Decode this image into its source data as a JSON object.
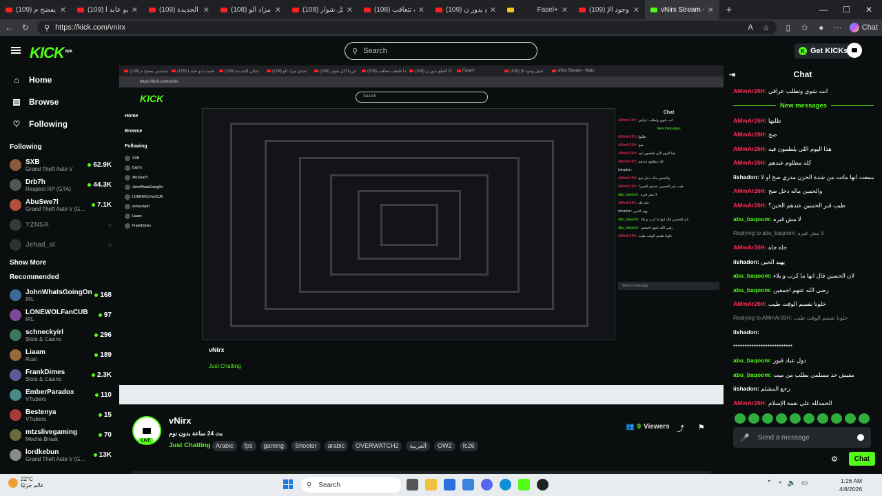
{
  "browser": {
    "tabs": [
      {
        "title": "(109) شمسي يفضح م"
      },
      {
        "title": "(109) قست ابو عابد ا"
      },
      {
        "title": "(109) حياتي الجديدة"
      },
      {
        "title": "(108) تحدي مزاد الو"
      },
      {
        "title": "(108) جربنا أكل شوار"
      },
      {
        "title": "(108) اذا غلطت تتعاقب"
      },
      {
        "title": "(109) أنا أقطع بدور ن"
      },
      {
        "title": "Fasel+"
      },
      {
        "title": "(109) تخيل وجود الإ"
      },
      {
        "title": "vNirx Stream - Watc"
      }
    ],
    "url": "https://kick.com/vnirx",
    "copilot_label": "Chat"
  },
  "header": {
    "logo": "KICK",
    "logo_beta": "BETA",
    "search_placeholder": "Search",
    "get_kicks": "Get KICKs"
  },
  "sidebar": {
    "nav": [
      {
        "label": "Home",
        "icon": "home-icon"
      },
      {
        "label": "Browse",
        "icon": "browse-icon"
      },
      {
        "label": "Following",
        "icon": "heart-icon"
      }
    ],
    "following_title": "Following",
    "following": [
      {
        "name": "SXB",
        "game": "Grand Theft Auto V",
        "viewers": "62.9K"
      },
      {
        "name": "Drb7h",
        "game": "Respect RP (GTA)",
        "viewers": "44.3K"
      },
      {
        "name": "AbuSwe7l",
        "game": "Grand Theft Auto V (G...",
        "viewers": "7.1K"
      },
      {
        "name": "YZNSA",
        "game": "",
        "viewers": ""
      },
      {
        "name": "Jehad_al",
        "game": "",
        "viewers": ""
      }
    ],
    "show_more": "Show More",
    "recommended_title": "Recommended",
    "recommended": [
      {
        "name": "JohnWhatsGoingOn",
        "game": "IRL",
        "viewers": "168"
      },
      {
        "name": "LONEWOLFanCUB",
        "game": "IRL",
        "viewers": "97"
      },
      {
        "name": "schneckyirl",
        "game": "Slots & Casino",
        "viewers": "296"
      },
      {
        "name": "Liaam",
        "game": "Rust",
        "viewers": "189"
      },
      {
        "name": "FrankDimes",
        "game": "Slots & Casino",
        "viewers": "2.3K"
      },
      {
        "name": "EmberParadox",
        "game": "VTubers",
        "viewers": "110"
      },
      {
        "name": "Bestenya",
        "game": "VTubers",
        "viewers": "15"
      },
      {
        "name": "mtzslivegaming",
        "game": "Mecha Break",
        "viewers": "70"
      },
      {
        "name": "lordkebun",
        "game": "Grand Theft Auto V (G...",
        "viewers": "13K"
      }
    ]
  },
  "stream": {
    "name": "vNirx",
    "live": "LIVE",
    "title": "بث 24 ساعة بدون نوم",
    "category": "Just Chatting",
    "tags": [
      "Arabic",
      "fps",
      "gaming",
      "Shooter",
      "arabic",
      "OVERWATCH2",
      "العربية",
      "OW2",
      "fc26"
    ],
    "viewers_count": "9",
    "viewers_label": "Viewers"
  },
  "chat": {
    "title": "Chat",
    "new_messages": "New messages",
    "first": {
      "user": "AMmAr26H:",
      "text": " انت شوي وتطلب عراقي"
    },
    "messages": [
      {
        "user": "AMmAr26H:",
        "text": " طلبها",
        "color": "red"
      },
      {
        "user": "AMmAr26H:",
        "text": " صح",
        "color": "red"
      },
      {
        "user": "AMmAr26H:",
        "text": " هذا اليوم اللي يلطمون فيه",
        "color": "red"
      },
      {
        "user": "AMmAr26H:",
        "text": " كله مظلوم عندهم",
        "color": "red"
      },
      {
        "user": "iishadon:",
        "text": " و رقية سمعت انها ماتت من شدة الحزن مدري صح او لا",
        "color": "white"
      },
      {
        "user": "AMmAr26H:",
        "text": " والحسن ماله دخل صح",
        "color": "red"
      },
      {
        "user": "AMmAr26H:",
        "text": " طيب قبر الحسين عندهم الحين؟",
        "color": "red"
      },
      {
        "user": "abu_baqoom:",
        "text": " لا مش قبره",
        "color": "green"
      },
      {
        "user": "",
        "text": "Replying to abu_baqoom: لا مش قبره",
        "color": "reply"
      },
      {
        "user": "AMmAr26H:",
        "text": " جاه جاه",
        "color": "red"
      },
      {
        "user": "iishadon:",
        "text": " يهيد الحين",
        "color": "white"
      },
      {
        "user": "abu_baqoom:",
        "text": " لان الحسين قال انها ما كرب و بلاء",
        "color": "green"
      },
      {
        "user": "abu_baqoom:",
        "text": " رضى الله عنهم اجمعين",
        "color": "green"
      },
      {
        "user": "AMmAr26H:",
        "text": " خلونا نقسم الوقت طيب",
        "color": "red"
      },
      {
        "user": "",
        "text": "Replying to AMmAr26H: خلونا نقسم الوقت طيب",
        "color": "reply"
      },
      {
        "user": "iishadon:",
        "text": "",
        "color": "white"
      },
      {
        "user": "",
        "text": "**************************",
        "color": "plain"
      },
      {
        "user": "abu_baqoom:",
        "text": " دول عباد قبور",
        "color": "green"
      },
      {
        "user": "abu_baqoom:",
        "text": " مفيش حد مسلمي يطلب من ميت",
        "color": "green"
      },
      {
        "user": "iishadon:",
        "text": " رجع المشلم",
        "color": "white"
      },
      {
        "user": "AMmAr26H:",
        "text": " الحمدلله على نعمة الإسلام",
        "color": "red"
      }
    ],
    "input_placeholder": "Send a message",
    "send_label": "Chat"
  },
  "taskbar": {
    "temp": "22°C",
    "weather_text": "عالم جزئيًا",
    "search_label": "Search",
    "time": "1:26 AM",
    "date": "4/8/2026"
  },
  "colors": {
    "accent": "#53fc18",
    "background": "#0b0e0f",
    "username_red": "#ff2d55"
  },
  "mirrored_stream": {
    "search": "Search",
    "url": "https://kick.com/vnirx",
    "chat_title": "Chat",
    "stream_name": "vNirx",
    "send": "Send a message"
  }
}
